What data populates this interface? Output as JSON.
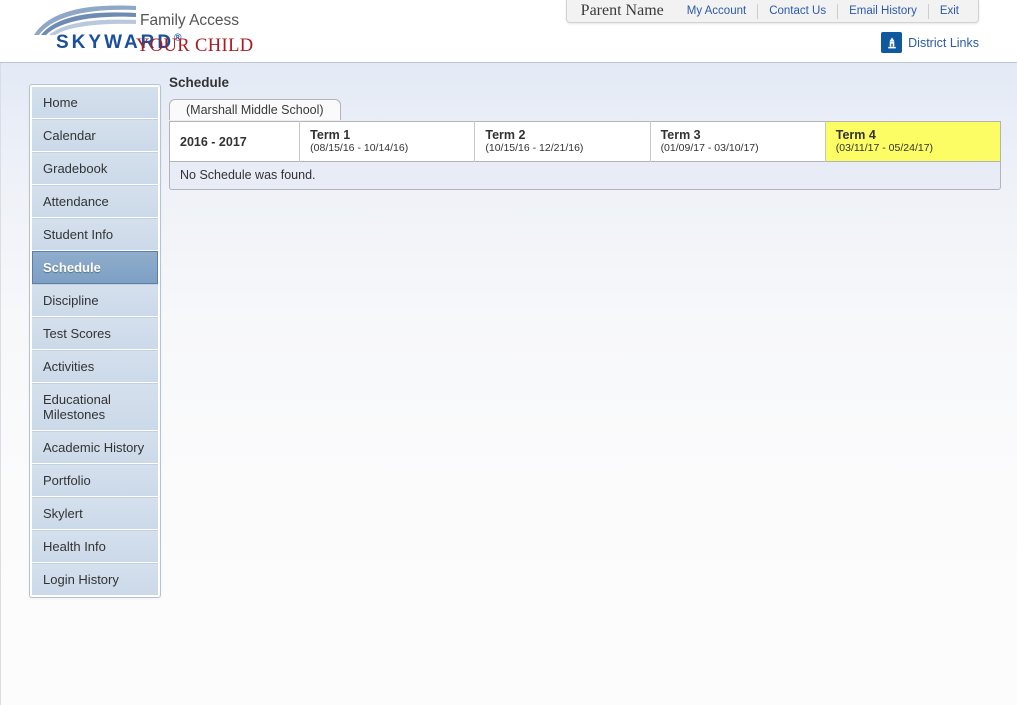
{
  "header": {
    "brand": "SKYWARD",
    "brand_registered": "®",
    "app_title": "Family Access",
    "child_name": "YOUR CHILD",
    "logo_icon": "skyward-swoosh-logo"
  },
  "account_bar": {
    "parent_name": "Parent Name",
    "links": [
      {
        "label": "My Account"
      },
      {
        "label": "Contact Us"
      },
      {
        "label": "Email History"
      },
      {
        "label": "Exit"
      }
    ]
  },
  "district_links": {
    "label": "District Links",
    "icon": "district-building-icon"
  },
  "sidebar": {
    "items": [
      {
        "label": "Home",
        "selected": false
      },
      {
        "label": "Calendar",
        "selected": false
      },
      {
        "label": "Gradebook",
        "selected": false
      },
      {
        "label": "Attendance",
        "selected": false
      },
      {
        "label": "Student Info",
        "selected": false
      },
      {
        "label": "Schedule",
        "selected": true
      },
      {
        "label": "Discipline",
        "selected": false
      },
      {
        "label": "Test Scores",
        "selected": false
      },
      {
        "label": "Activities",
        "selected": false
      },
      {
        "label": "Educational Milestones",
        "selected": false
      },
      {
        "label": "Academic History",
        "selected": false
      },
      {
        "label": "Portfolio",
        "selected": false
      },
      {
        "label": "Skylert",
        "selected": false
      },
      {
        "label": "Health Info",
        "selected": false
      },
      {
        "label": "Login History",
        "selected": false
      }
    ]
  },
  "main": {
    "page_title": "Schedule",
    "school_tab": "(Marshall Middle School)",
    "school_year": "2016 - 2017",
    "terms": [
      {
        "name": "Term 1",
        "dates": "(08/15/16 - 10/14/16)",
        "current": false
      },
      {
        "name": "Term 2",
        "dates": "(10/15/16 - 12/21/16)",
        "current": false
      },
      {
        "name": "Term 3",
        "dates": "(01/09/17 - 03/10/17)",
        "current": false
      },
      {
        "name": "Term 4",
        "dates": "(03/11/17 - 05/24/17)",
        "current": true
      }
    ],
    "empty_message": "No Schedule was found."
  },
  "colors": {
    "brand_blue": "#1a4f9c",
    "child_red": "#a81b21",
    "link_blue": "#2c5aa8",
    "highlight_yellow": "#fcfc65",
    "selected_nav": "#7ea0c4"
  }
}
